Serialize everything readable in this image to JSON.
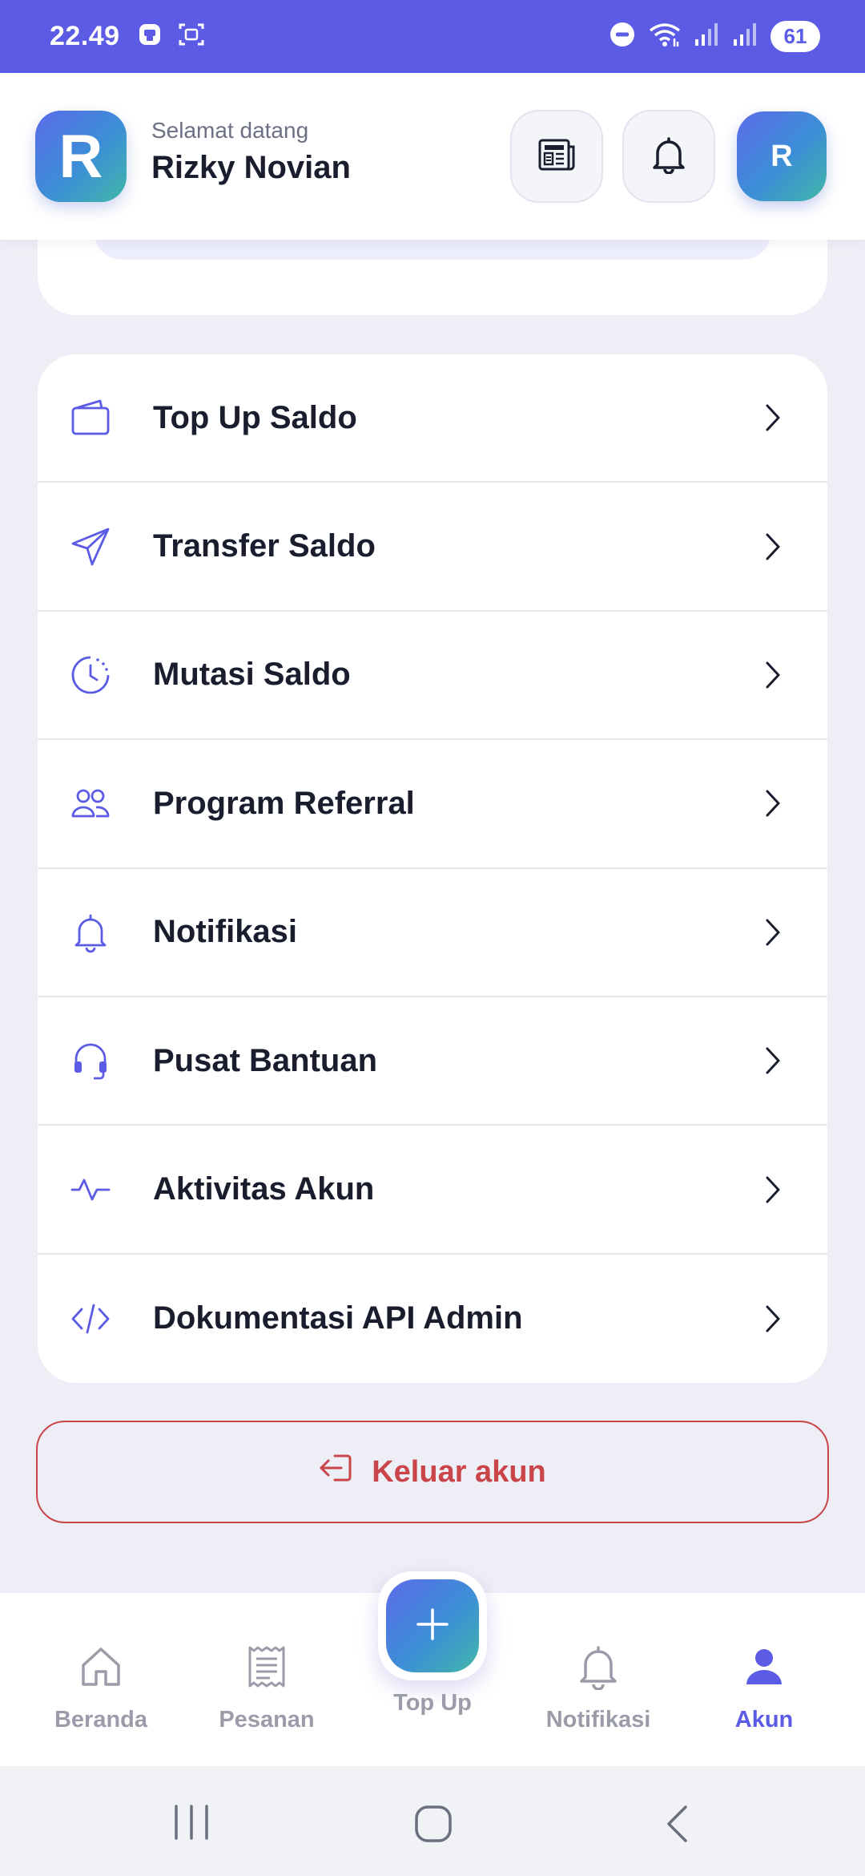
{
  "status_bar": {
    "time": "22.49",
    "battery": "61",
    "icons": [
      "app-notification-icon",
      "screenshot-icon",
      "do-not-disturb-icon",
      "wifi-icon",
      "signal-icon",
      "signal-icon"
    ]
  },
  "header": {
    "logo_letter": "R",
    "greeting": "Selamat datang",
    "user_name": "Rizky Novian",
    "avatar_letter": "R",
    "actions": [
      "news-icon",
      "bell-icon"
    ]
  },
  "menu": {
    "items": [
      {
        "label": "Top Up Saldo",
        "icon": "wallet-icon"
      },
      {
        "label": "Transfer Saldo",
        "icon": "send-icon"
      },
      {
        "label": "Mutasi Saldo",
        "icon": "history-clock-icon"
      },
      {
        "label": "Program Referral",
        "icon": "users-icon"
      },
      {
        "label": "Notifikasi",
        "icon": "bell-icon"
      },
      {
        "label": "Pusat Bantuan",
        "icon": "headset-icon"
      },
      {
        "label": "Aktivitas Akun",
        "icon": "activity-icon"
      },
      {
        "label": "Dokumentasi API Admin",
        "icon": "code-icon"
      }
    ]
  },
  "logout": {
    "label": "Keluar akun",
    "icon": "logout-icon"
  },
  "bottom_nav": {
    "items": [
      {
        "label": "Beranda",
        "icon": "home-icon",
        "active": false
      },
      {
        "label": "Pesanan",
        "icon": "receipt-icon",
        "active": false
      },
      {
        "label": "Top Up",
        "icon": "plus-icon",
        "active": false
      },
      {
        "label": "Notifikasi",
        "icon": "bell-icon",
        "active": false
      },
      {
        "label": "Akun",
        "icon": "user-icon",
        "active": true
      }
    ]
  },
  "colors": {
    "accent": "#5b5be6",
    "danger": "#c9454a",
    "text": "#1a1d2e",
    "muted": "#9a9caa",
    "background": "#eeeff6"
  }
}
